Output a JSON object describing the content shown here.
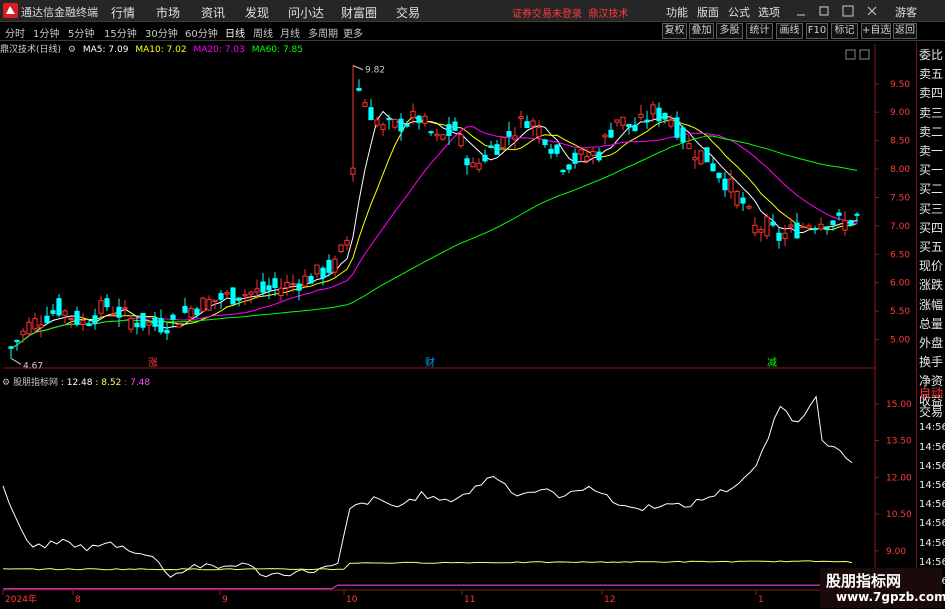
{
  "app": {
    "title": "通达信金融终端"
  },
  "menu": [
    "行情",
    "市场",
    "资讯",
    "发现",
    "问小达",
    "财富圈",
    "交易"
  ],
  "notice": {
    "login": "证券交易未登录",
    "stock": "鼎汉技术"
  },
  "menu_right": [
    "功能",
    "版面",
    "公式",
    "选项",
    "游客"
  ],
  "period_tabs": [
    "分时",
    "1分钟",
    "5分钟",
    "15分钟",
    "30分钟",
    "60分钟",
    "日线",
    "周线",
    "月线",
    "多周期",
    "更多"
  ],
  "active_period": "日线",
  "toolbar_buttons": [
    "复权",
    "叠加",
    "多股",
    "统计",
    "画线",
    "F10",
    "标记",
    "+自选",
    "返回"
  ],
  "info": {
    "name": "鼎汉技术(日线)",
    "ma5": "MA5: 7.09",
    "ma10": "MA10: 7.02",
    "ma20": "MA20: 7.03",
    "ma60": "MA60: 7.85"
  },
  "indicator": {
    "name": "股朋指标网",
    "v1": ": 12.48",
    "v2": ": 8.52",
    "v3": ": 7.48"
  },
  "right_panel": [
    "委比",
    "卖五",
    "卖四",
    "卖三",
    "卖二",
    "卖一",
    "买一",
    "买二",
    "买三",
    "买四",
    "买五",
    "现价",
    "涨跌",
    "涨幅",
    "总量",
    "外盘",
    "换手",
    "净资",
    "收益",
    "自动",
    "交易",
    "14:56",
    "14:56",
    "14:56",
    "14:56",
    "14:56",
    "14:56",
    "14:56",
    "14:56",
    "14:56"
  ],
  "chart_data": {
    "type": "candlestick",
    "price_axis": {
      "ticks": [
        5.0,
        5.5,
        6.0,
        6.5,
        7.0,
        7.5,
        8.0,
        8.5,
        9.0,
        9.5
      ],
      "range": [
        4.5,
        10.2
      ]
    },
    "high_label": "9.82",
    "low_label": "4.67",
    "markers": [
      "涨",
      "财",
      "减"
    ],
    "x_labels": [
      "2024年",
      "8",
      "9",
      "10",
      "11",
      "12",
      "1"
    ],
    "indicator_axis": {
      "ticks": [
        9.0,
        10.5,
        12.0,
        13.5,
        15.0
      ],
      "range": [
        7.4,
        16.3
      ]
    },
    "indicator_lines": [
      "white",
      "yellow",
      "magenta"
    ],
    "colors": {
      "up": "#ff3232",
      "down": "#00ffff",
      "ma5": "#ffffff",
      "ma10": "#ffff00",
      "ma20": "#ff00ff",
      "ma60": "#00ff00"
    }
  },
  "watermark": {
    "line1": "股朋指标网",
    "line2": "www.7gpzb.com"
  }
}
